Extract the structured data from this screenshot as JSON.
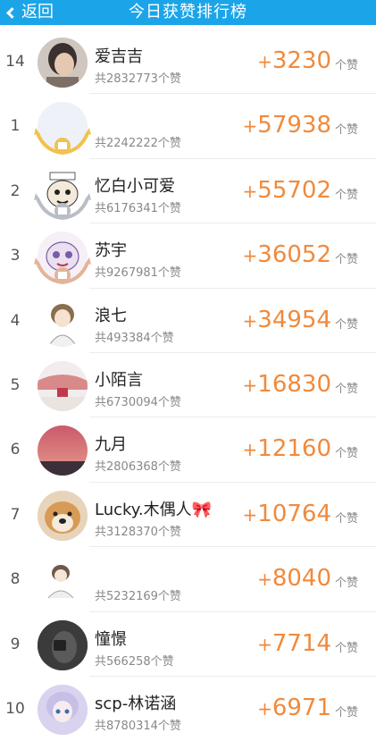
{
  "header": {
    "back_label": "返回",
    "title": "今日获赞排行榜"
  },
  "unit_label": "个赞",
  "rows": [
    {
      "rank": "14",
      "name": "爱吉吉",
      "total": "共2832773个赞",
      "likes": "3230"
    },
    {
      "rank": "1",
      "name": "",
      "total": "共2242222个赞",
      "likes": "57938"
    },
    {
      "rank": "2",
      "name": "忆白小可爱",
      "total": "共6176341个赞",
      "likes": "55702"
    },
    {
      "rank": "3",
      "name": "苏宇",
      "total": "共9267981个赞",
      "likes": "36052"
    },
    {
      "rank": "4",
      "name": "浪七",
      "total": "共493384个赞",
      "likes": "34954"
    },
    {
      "rank": "5",
      "name": "小陌言",
      "total": "共6730094个赞",
      "likes": "16830"
    },
    {
      "rank": "6",
      "name": "九月",
      "total": "共2806368个赞",
      "likes": "12160"
    },
    {
      "rank": "7",
      "name": "Lucky.木偶人🎀",
      "total": "共3128370个赞",
      "likes": "10764"
    },
    {
      "rank": "8",
      "name": "",
      "total": "共5232169个赞",
      "likes": "8040"
    },
    {
      "rank": "9",
      "name": "憧憬",
      "total": "共566258个赞",
      "likes": "7714"
    },
    {
      "rank": "10",
      "name": "scp-林诺涵",
      "total": "共8780314个赞",
      "likes": "6971"
    }
  ],
  "colors": {
    "header": "#1ba5e8",
    "likes": "#f08a3c",
    "gold": "#f2c14e",
    "silver": "#b9bec6",
    "bronze": "#e3b39a"
  },
  "medals": [
    "gold",
    "silver",
    "bronze"
  ]
}
